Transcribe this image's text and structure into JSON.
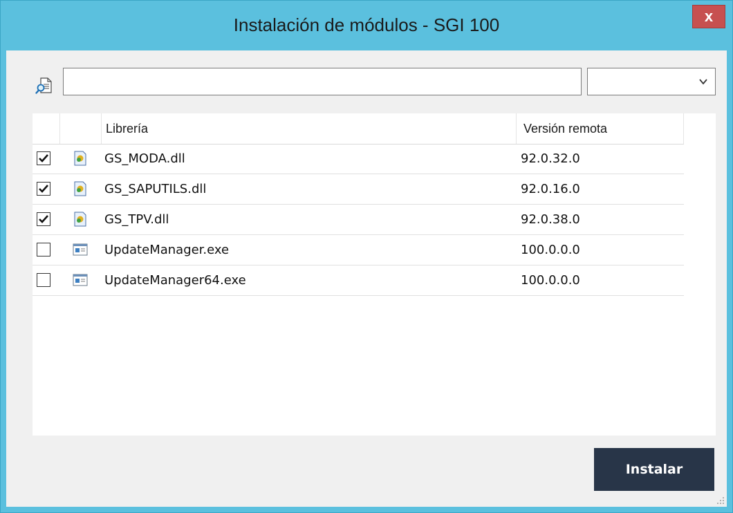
{
  "window": {
    "title": "Instalación de módulos - SGI 100",
    "close_label": "x"
  },
  "filter": {
    "search_value": "",
    "combo_value": ""
  },
  "grid": {
    "columns": {
      "library": "Librería",
      "remote_version": "Versión remota"
    },
    "rows": [
      {
        "name": "GS_MODA.dll",
        "version": "92.0.32.0",
        "checked": true,
        "icon": "dll-icon"
      },
      {
        "name": "GS_SAPUTILS.dll",
        "version": "92.0.16.0",
        "checked": true,
        "icon": "dll-icon"
      },
      {
        "name": "GS_TPV.dll",
        "version": "92.0.38.0",
        "checked": true,
        "icon": "dll-icon"
      },
      {
        "name": "UpdateManager.exe",
        "version": "100.0.0.0",
        "checked": false,
        "icon": "exe-icon"
      },
      {
        "name": "UpdateManager64.exe",
        "version": "100.0.0.0",
        "checked": false,
        "icon": "exe-icon"
      }
    ]
  },
  "footer": {
    "install_label": "Instalar"
  },
  "colors": {
    "titlebar": "#5bc0de",
    "close": "#c75050",
    "install_button": "#283548"
  }
}
